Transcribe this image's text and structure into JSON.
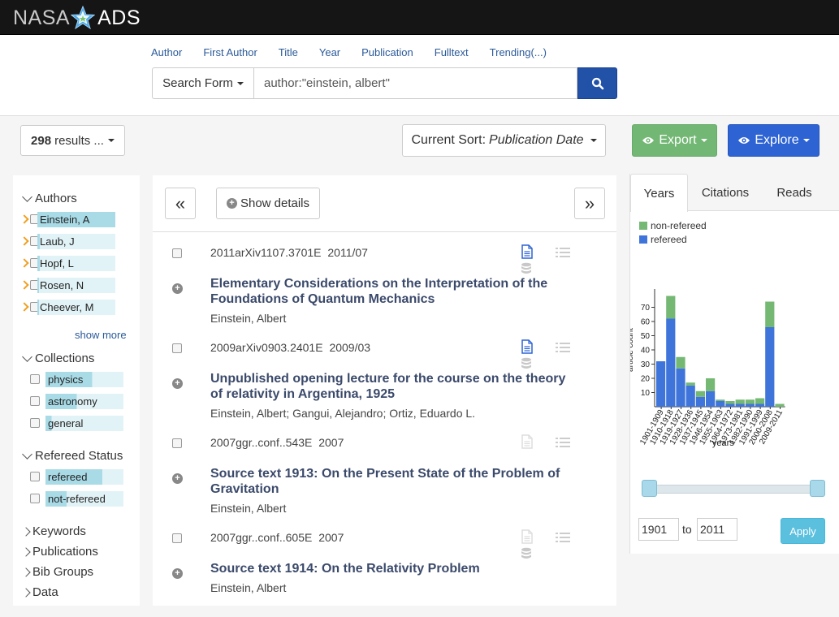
{
  "brand": {
    "left": "NASA",
    "right": "ADS"
  },
  "quick_fields": [
    "Author",
    "First Author",
    "Title",
    "Year",
    "Publication",
    "Fulltext",
    "Trending(...)"
  ],
  "search": {
    "form_label": "Search Form",
    "query": "author:\"einstein, albert\""
  },
  "results_count": {
    "number": "298",
    "suffix": "results ..."
  },
  "sort": {
    "prefix": "Current Sort:",
    "value": "Publication Date"
  },
  "export_label": "Export",
  "explore_label": "Explore",
  "facets": {
    "authors": {
      "title": "Authors",
      "items": [
        {
          "label": "Einstein, A",
          "fill": 1.0
        },
        {
          "label": "Laub, J",
          "fill": 0.03
        },
        {
          "label": "Hopf, L",
          "fill": 0.03
        },
        {
          "label": "Rosen, N",
          "fill": 0.02
        },
        {
          "label": "Cheever, M",
          "fill": 0.02
        }
      ],
      "show_more": "show more"
    },
    "collections": {
      "title": "Collections",
      "items": [
        {
          "label": "physics",
          "fill": 0.6
        },
        {
          "label": "astronomy",
          "fill": 0.4
        },
        {
          "label": "general",
          "fill": 0.08
        }
      ]
    },
    "refereed": {
      "title": "Refereed Status",
      "items": [
        {
          "label": "refereed",
          "fill": 0.73
        },
        {
          "label": "not-refereed",
          "fill": 0.27
        }
      ]
    },
    "collapsed": [
      "Keywords",
      "Publications",
      "Bib Groups",
      "Data"
    ]
  },
  "results_nav": {
    "prev": "«",
    "next": "»",
    "show_details": "Show details"
  },
  "results": [
    {
      "bibcode": "2011arXiv1107.3701E",
      "date": "2011/07",
      "title": "Elementary Considerations on the Interpretation of the Foundations of Quantum Mechanics",
      "authors": "Einstein, Albert",
      "fulltext": true
    },
    {
      "bibcode": "2009arXiv0903.2401E",
      "date": "2009/03",
      "title": "Unpublished opening lecture for the course on the theory of relativity in Argentina, 1925",
      "authors": "Einstein, Albert;  Gangui, Alejandro;  Ortiz, Eduardo L.",
      "fulltext": true
    },
    {
      "bibcode": "2007ggr..conf..543E",
      "date": "2007",
      "title": "Source text 1913: On the Present State of the Problem of Gravitation",
      "authors": "Einstein, Albert",
      "fulltext": false
    },
    {
      "bibcode": "2007ggr..conf..605E",
      "date": "2007",
      "title": "Source text 1914: On the Relativity Problem",
      "authors": "Einstein, Albert",
      "fulltext": false
    }
  ],
  "graph_tabs": [
    "Years",
    "Citations",
    "Reads"
  ],
  "chart_data": {
    "type": "bar",
    "stacked": true,
    "categories": [
      "1901-1909",
      "1910-1918",
      "1919-1927",
      "1928-1936",
      "1937-1945",
      "1946-1954",
      "1955-1963",
      "1964-1972",
      "1973-1981",
      "1982-1990",
      "1991-1999",
      "2000-2008",
      "2009-2011"
    ],
    "series": [
      {
        "name": "refereed",
        "color": "#3f74db",
        "values": [
          32,
          62,
          27,
          15,
          7,
          11,
          4,
          2,
          2,
          2,
          2,
          56,
          0
        ]
      },
      {
        "name": "non-refereed",
        "color": "#74b874",
        "values": [
          0,
          16,
          8,
          2,
          4,
          9,
          1,
          2,
          3,
          3,
          4,
          18,
          2
        ]
      }
    ],
    "ylabel": "article count",
    "xlabel": "years",
    "yticks": [
      10,
      20,
      30,
      40,
      50,
      60,
      70
    ],
    "ylim": [
      0,
      80
    ],
    "legend": "top-left"
  },
  "year_range": {
    "from": "1901",
    "to_label": "to",
    "to": "2011",
    "apply": "Apply"
  }
}
